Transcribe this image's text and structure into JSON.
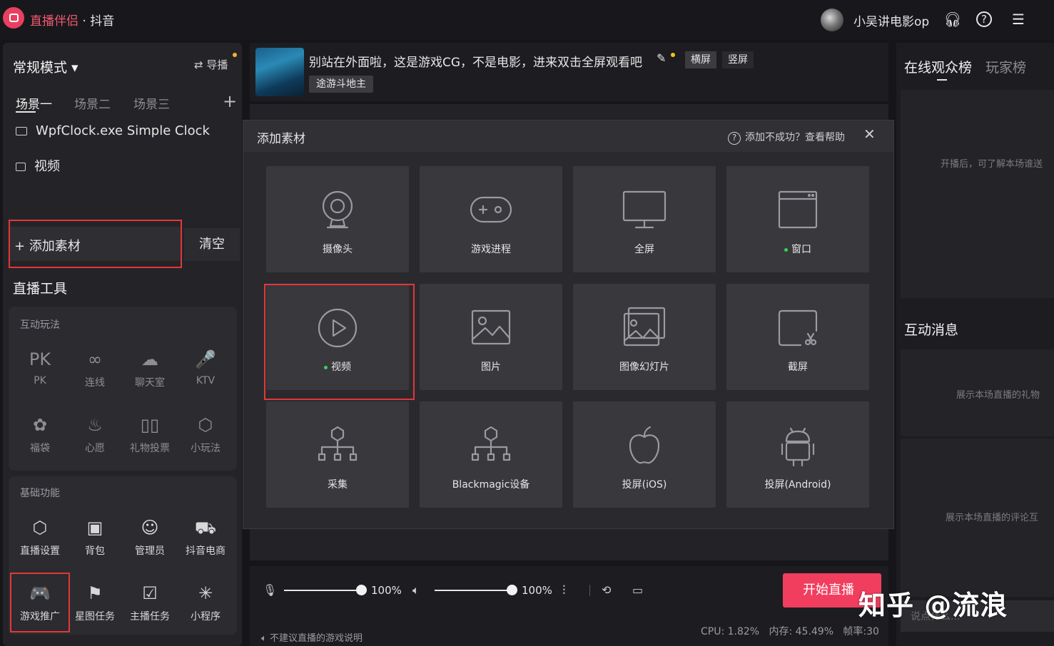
{
  "app": {
    "name": "直播伴侣",
    "separator": " · ",
    "platform": "抖音"
  },
  "user": {
    "name": "小吴讲电影op"
  },
  "header_icons": [
    "headset-icon",
    "help-icon",
    "menu-icon"
  ],
  "left": {
    "mode": "常规模式 ▾",
    "guide": "导播",
    "scenes": [
      "场景一",
      "场景二",
      "场景三"
    ],
    "sources": [
      {
        "label": "WpfClock.exe Simple Clock",
        "icon": "window-icon"
      },
      {
        "label": "视频",
        "icon": "video-icon"
      }
    ],
    "add_source": "添加素材",
    "clear": "清空",
    "tools_title": "直播工具",
    "interactive": {
      "title": "互动玩法",
      "items": [
        {
          "label": "PK",
          "glyph": "PK"
        },
        {
          "label": "连线",
          "glyph": "∞"
        },
        {
          "label": "聊天室",
          "glyph": "☁"
        },
        {
          "label": "KTV",
          "glyph": "🎤"
        },
        {
          "label": "福袋",
          "glyph": "✿"
        },
        {
          "label": "心愿",
          "glyph": "♨"
        },
        {
          "label": "礼物投票",
          "glyph": "▯▯"
        },
        {
          "label": "小玩法",
          "glyph": "⬡"
        }
      ]
    },
    "basic": {
      "title": "基础功能",
      "items": [
        {
          "label": "直播设置",
          "glyph": "⬡"
        },
        {
          "label": "背包",
          "glyph": "▣"
        },
        {
          "label": "管理员",
          "glyph": "☺"
        },
        {
          "label": "抖音电商",
          "glyph": "⛟"
        },
        {
          "label": "游戏推广",
          "glyph": "🎮"
        },
        {
          "label": "星图任务",
          "glyph": "⚑"
        },
        {
          "label": "主播任务",
          "glyph": "☑"
        },
        {
          "label": "小程序",
          "glyph": "✳"
        }
      ]
    }
  },
  "stream": {
    "title": "别站在外面啦，这是游戏CG，不是电影，进来双击全屏观看吧",
    "orientation": [
      "横屏",
      "竖屏"
    ],
    "game_tag": "途游斗地主"
  },
  "dialog": {
    "title": "添加素材",
    "help": "添加不成功？查看帮助",
    "close": "✕",
    "tiles": [
      {
        "label": "摄像头",
        "icon": "camera-icon",
        "dot": false
      },
      {
        "label": "游戏进程",
        "icon": "gamepad-icon",
        "dot": false
      },
      {
        "label": "全屏",
        "icon": "monitor-icon",
        "dot": false
      },
      {
        "label": "窗口",
        "icon": "window-icon",
        "dot": true
      },
      {
        "label": "视频",
        "icon": "play-icon",
        "dot": true
      },
      {
        "label": "图片",
        "icon": "image-icon",
        "dot": false
      },
      {
        "label": "图像幻灯片",
        "icon": "slideshow-icon",
        "dot": false
      },
      {
        "label": "截屏",
        "icon": "screenshot-icon",
        "dot": false
      },
      {
        "label": "采集",
        "icon": "capture-icon",
        "dot": false
      },
      {
        "label": "Blackmagic设备",
        "icon": "blackmagic-icon",
        "dot": false
      },
      {
        "label": "投屏(iOS)",
        "icon": "apple-icon",
        "dot": false
      },
      {
        "label": "投屏(Android)",
        "icon": "android-icon",
        "dot": false
      }
    ]
  },
  "controls": {
    "mic_volume": "100%",
    "speaker_volume": "100%",
    "start_live": "开始直播",
    "hint": "不建议直播的游戏说明",
    "cpu": "CPU: 1.82%",
    "memory": "内存: 45.49%",
    "fps": "帧率:30"
  },
  "right": {
    "tabs": [
      "在线观众榜",
      "玩家榜"
    ],
    "audience_hint": "开播后，可了解本场谁送",
    "messages_title": "互动消息",
    "gift_hint": "展示本场直播的礼物",
    "comment_hint": "展示本场直播的评论互",
    "chat_placeholder": "说点什么..."
  },
  "watermark": "知乎 @流浪",
  "colors": {
    "accent": "#f13e5e",
    "highlight_border": "#e2373a",
    "active_dot": "#3ad15a"
  }
}
